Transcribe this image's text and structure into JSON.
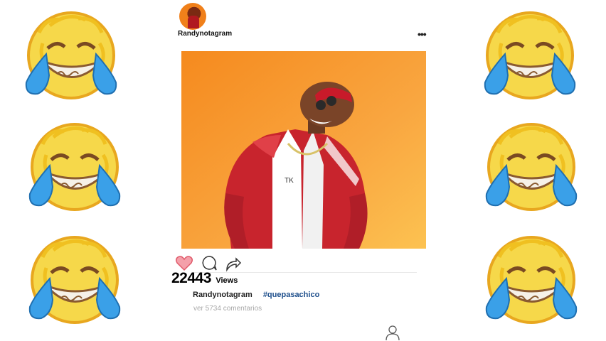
{
  "post": {
    "username": "Randynotagram",
    "more_menu": "•••",
    "views_count": "22443",
    "views_label": "Views",
    "caption_user": "Randynotagram",
    "hashtag": "#quepasachico",
    "comments_link": "ver 5734 comentarios"
  },
  "colors": {
    "photo_background": "#f7a23a",
    "jacket": "#c8242d",
    "like_heart": "#f4a0aa",
    "hashtag": "#1e4f8c",
    "emoji_face": "#f6d84a",
    "emoji_tears": "#3aa0e8"
  },
  "icons": {
    "emojis": "face-with-tears-of-joy",
    "like": "heart-icon",
    "comment": "comment-icon",
    "share": "share-arrow-icon",
    "profile": "profile-icon"
  }
}
